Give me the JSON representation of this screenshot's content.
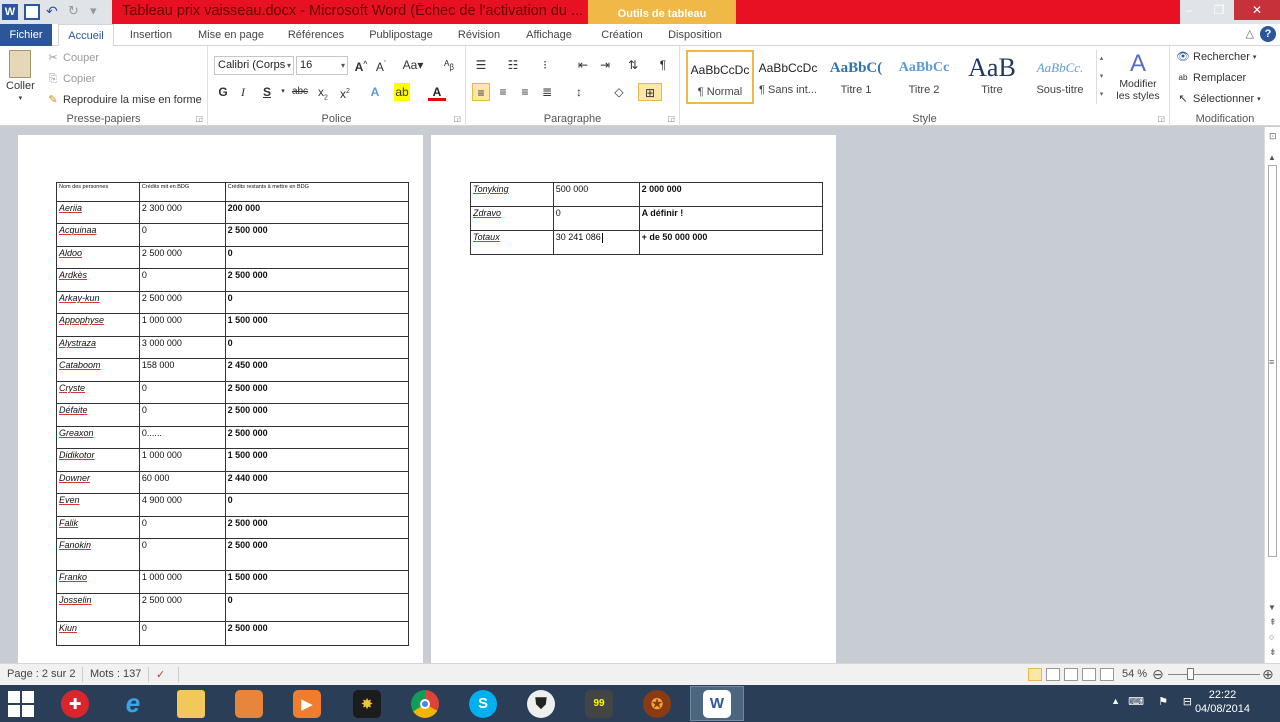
{
  "window": {
    "title": "Tableau prix vaisseau.docx - Microsoft Word (Échec de l'activation du ...",
    "context_tab_title": "Outils de tableau"
  },
  "tabs": [
    "Fichier",
    "Accueil",
    "Insertion",
    "Mise en page",
    "Références",
    "Publipostage",
    "Révision",
    "Affichage",
    "Création",
    "Disposition"
  ],
  "ribbon": {
    "clipboard": {
      "label": "Presse-papiers",
      "paste": "Coller",
      "cut": "Couper",
      "copy": "Copier",
      "format_painter": "Reproduire la mise en forme"
    },
    "font": {
      "label": "Police",
      "font_name": "Calibri (Corps",
      "font_size": "16",
      "bold": "G",
      "italic": "I",
      "underline": "S",
      "strike": "abc",
      "change_case": "Aa"
    },
    "paragraph": {
      "label": "Paragraphe"
    },
    "styles": {
      "label": "Style",
      "items": [
        {
          "preview": "AaBbCcDc",
          "name": "¶ Normal"
        },
        {
          "preview": "AaBbCcDc",
          "name": "¶ Sans int..."
        },
        {
          "preview": "AaBbC(",
          "name": "Titre 1"
        },
        {
          "preview": "AaBbCc",
          "name": "Titre 2"
        },
        {
          "preview": "AaB",
          "name": "Titre"
        },
        {
          "preview": "AaBbCc.",
          "name": "Sous-titre"
        }
      ],
      "change_styles": "Modifier les styles"
    },
    "editing": {
      "label": "Modification",
      "find": "Rechercher",
      "replace": "Remplacer",
      "select": "Sélectionner"
    }
  },
  "table1": {
    "headers": [
      "Nom des personnes",
      "Crédits mit en BDG",
      "Crédits restants à mettre en BDG"
    ],
    "rows": [
      [
        "Aeriia",
        "2 300 000",
        "200 000"
      ],
      [
        "Acquinaa",
        "0",
        "2 500 000"
      ],
      [
        "Aldoo",
        "2 500 000",
        "0"
      ],
      [
        "Ardkès",
        "0",
        "2 500 000"
      ],
      [
        "Arkay-kun",
        "2 500 000",
        "0"
      ],
      [
        "Appophyse",
        "1 000 000",
        "1 500 000"
      ],
      [
        "Alystraza",
        "3 000 000",
        "0"
      ],
      [
        "Cataboom",
        "158 000",
        "2 450 000"
      ],
      [
        "Cryste",
        "0",
        "2 500 000"
      ],
      [
        "Défaite",
        "0",
        "2 500 000"
      ],
      [
        "Greaxon",
        "0......",
        "2 500 000"
      ],
      [
        "Didikotor",
        "1 000 000",
        "1 500 000"
      ],
      [
        "Downer",
        "60 000",
        "2 440 000"
      ],
      [
        "Even",
        "4 900 000",
        "0"
      ],
      [
        "Falik",
        "0",
        "2 500 000"
      ],
      [
        "Fanokin",
        "0",
        "2 500 000"
      ],
      [
        "Franko",
        "1 000 000",
        "1 500 000"
      ],
      [
        "Josselin",
        "2 500 000",
        "0"
      ],
      [
        "Kiun",
        "0",
        "2 500 000"
      ]
    ]
  },
  "table2": {
    "rows": [
      [
        "Tonyking",
        "500 000",
        "2 000 000"
      ],
      [
        "Zdravo",
        "0",
        "A définir !"
      ],
      [
        "Totaux",
        "30 241 086",
        "+ de 50 000 000"
      ]
    ]
  },
  "status": {
    "page": "Page : 2 sur 2",
    "words": "Mots : 137",
    "zoom": "54 %"
  },
  "clock": {
    "time": "22:22",
    "date": "04/08/2014"
  }
}
